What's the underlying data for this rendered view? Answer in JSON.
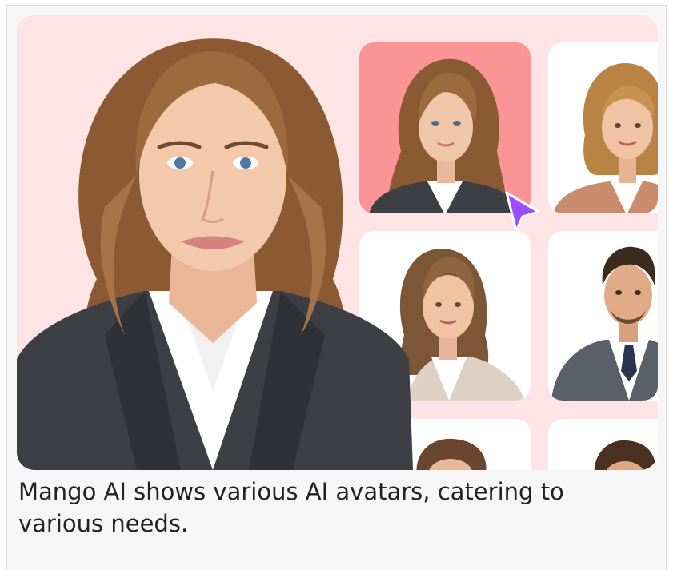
{
  "caption": {
    "text": "Mango AI shows various AI avatars, catering to various needs."
  },
  "illustration": {
    "description_icon": "avatar-gallery-illustration",
    "background_color": "#ffe4e6",
    "selected_tile_color": "#fb9494",
    "cursor_color": "#9b4dff",
    "avatar_count": 7
  }
}
